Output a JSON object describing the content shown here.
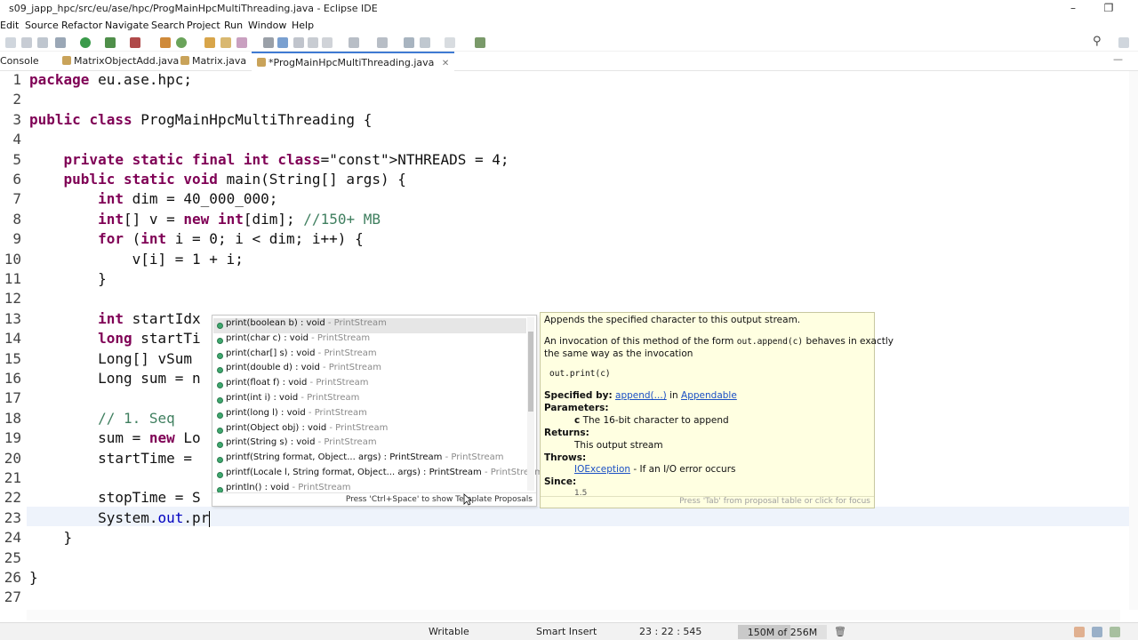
{
  "window": {
    "title": "s09_japp_hpc/src/eu/ase/hpc/ProgMainHpcMultiThreading.java - Eclipse IDE",
    "minimize": "–",
    "maximize": "❐"
  },
  "menu": [
    "Edit",
    "Source",
    "Refactor",
    "Navigate",
    "Search",
    "Project",
    "Run",
    "Window",
    "Help"
  ],
  "tabs": [
    {
      "label": "Console",
      "active": false
    },
    {
      "label": "MatrixObjectAdd.java",
      "active": false
    },
    {
      "label": "Matrix.java",
      "active": false
    },
    {
      "label": "*ProgMainHpcMultiThreading.java",
      "active": true,
      "close": "✕"
    }
  ],
  "editor": {
    "line_numbers": [
      "1",
      "2",
      "3",
      "4",
      "5",
      "6",
      "7",
      "8",
      "9",
      "10",
      "11",
      "12",
      "13",
      "14",
      "15",
      "16",
      "17",
      "18",
      "19",
      "20",
      "21",
      "22",
      "23",
      "24",
      "25",
      "26",
      "27"
    ],
    "current_line": 23,
    "lines": [
      "package eu.ase.hpc;",
      "",
      "public class ProgMainHpcMultiThreading {",
      "",
      "    private static final int NTHREADS = 4;",
      "    public static void main(String[] args) {",
      "        int dim = 40_000_000;",
      "        int[] v = new int[dim]; //150+ MB",
      "        for (int i = 0; i < dim; i++) {",
      "            v[i] = 1 + i;",
      "        }",
      "",
      "        int startIdx",
      "        long startTi",
      "        Long[] vSum ",
      "        Long sum = n",
      "",
      "        // 1. Seq",
      "        sum = new Lo",
      "        startTime = ",
      "",
      "        stopTime = S",
      "        System.out.pr",
      "    }",
      "",
      "}",
      ""
    ]
  },
  "completion": {
    "items": [
      {
        "name": "print(boolean b) : void",
        "type": "PrintStream"
      },
      {
        "name": "print(char c) : void",
        "type": "PrintStream"
      },
      {
        "name": "print(char[] s) : void",
        "type": "PrintStream"
      },
      {
        "name": "print(double d) : void",
        "type": "PrintStream"
      },
      {
        "name": "print(float f) : void",
        "type": "PrintStream"
      },
      {
        "name": "print(int i) : void",
        "type": "PrintStream"
      },
      {
        "name": "print(long l) : void",
        "type": "PrintStream"
      },
      {
        "name": "print(Object obj) : void",
        "type": "PrintStream"
      },
      {
        "name": "print(String s) : void",
        "type": "PrintStream"
      },
      {
        "name": "printf(String format, Object... args) : PrintStream",
        "type": "PrintStream"
      },
      {
        "name": "printf(Locale l, String format, Object... args) : PrintStream",
        "type": "PrintStream"
      },
      {
        "name": "println() : void",
        "type": "PrintStream"
      }
    ],
    "footer": "Press 'Ctrl+Space' to show Template Proposals"
  },
  "javadoc": {
    "summary": "Appends the specified character to this output stream.",
    "line1": "An invocation of this method of the form",
    "code1": "out.append(c)",
    "line1b": "behaves in exactly",
    "line2": "the same way as the invocation",
    "code2": "out.print(c)",
    "specified_label": "Specified by:",
    "specified_link": "append(...)",
    "specified_in": "in",
    "specified_iface": "Appendable",
    "params_label": "Parameters:",
    "param_name": "c",
    "param_desc": "The 16-bit character to append",
    "returns_label": "Returns:",
    "returns_desc": "This output stream",
    "throws_label": "Throws:",
    "throws_link": "IOException",
    "throws_desc": "- If an I/O error occurs",
    "since_label": "Since:",
    "since_value": "1.5",
    "footer": "Press 'Tab' from proposal table or click for focus"
  },
  "status": {
    "writable": "Writable",
    "insert_mode": "Smart Insert",
    "position": "23 : 22 : 545",
    "memory": "150M of 256M",
    "memory_used_fraction": 0.586
  },
  "colors": {
    "keyword": "#7f0055",
    "comment": "#3f7f5f",
    "field": "#0000c0",
    "current_line": "#eef3fb",
    "doc_background": "#ffffe1",
    "active_tab_accent": "#3f7ad3"
  }
}
